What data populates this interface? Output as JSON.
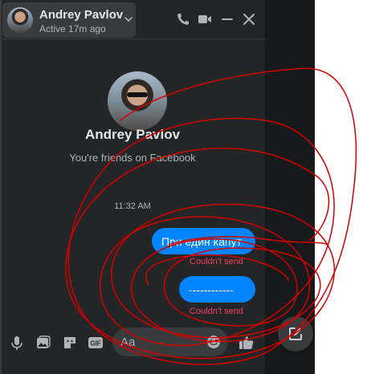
{
  "colors": {
    "panel": "#242526",
    "bubble": "#0084ff",
    "error": "#f3425f",
    "accent": "#2d88ff",
    "annotation": "#d40000"
  },
  "header": {
    "name": "Andrey Pavlov",
    "status": "Active 17m ago",
    "icons": [
      "chevron-down-icon",
      "phone-icon",
      "video-camera-icon",
      "minimize-icon",
      "close-icon"
    ]
  },
  "profile": {
    "name": "Andrey Pavlov",
    "subtitle": "You're friends on Facebook"
  },
  "conversation": {
    "timestamp": "11:32 AM",
    "messages": [
      {
        "text": "При един капут",
        "status": "Couldn't send"
      },
      {
        "text": "------------",
        "status": "Couldn't send"
      }
    ]
  },
  "composer": {
    "placeholder": "Aa",
    "icons": [
      "microphone-icon",
      "photo-icon",
      "sticker-icon",
      "gif-icon",
      "emoji-icon",
      "thumbs-up-icon"
    ]
  },
  "new_message_button": {
    "icon": "compose-icon"
  }
}
